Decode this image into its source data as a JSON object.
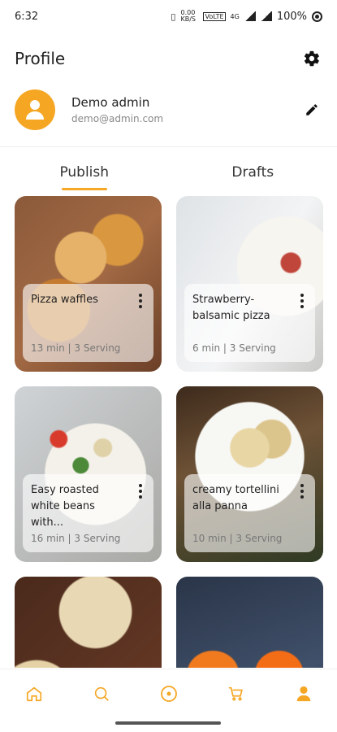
{
  "status_bar": {
    "time": "6:32",
    "net_speed": "0.00 KB/S",
    "network": "VoLTE",
    "signal_label": "4G",
    "battery": "100%"
  },
  "header": {
    "title": "Profile",
    "settings_icon": "gear-icon"
  },
  "profile": {
    "name": "Demo admin",
    "email": "demo@admin.com",
    "avatar_icon": "user-icon",
    "edit_icon": "pencil-icon"
  },
  "tabs": [
    {
      "label": "Publish",
      "active": true
    },
    {
      "label": "Drafts",
      "active": false
    }
  ],
  "recipes": [
    {
      "name": "Pizza waffles",
      "time": "13 min",
      "servings": "3 Serving",
      "meta": "13 min | 3 Serving"
    },
    {
      "name": "Strawberry-balsamic pizza",
      "time": "6 min",
      "servings": "3 Serving",
      "meta": "6 min | 3 Serving"
    },
    {
      "name": "Easy roasted white beans with...",
      "time": "16 min",
      "servings": "3 Serving",
      "meta": "16 min | 3 Serving"
    },
    {
      "name": "creamy tortellini alla panna",
      "time": "10 min",
      "servings": "3 Serving",
      "meta": "10 min | 3 Serving"
    },
    {
      "name": "",
      "meta": ""
    },
    {
      "name": "",
      "meta": ""
    }
  ],
  "bottom_nav": [
    {
      "icon": "home-icon",
      "active": false
    },
    {
      "icon": "search-icon",
      "active": false
    },
    {
      "icon": "add-circle-icon",
      "active": false
    },
    {
      "icon": "cart-icon",
      "active": false
    },
    {
      "icon": "profile-icon",
      "active": true
    }
  ],
  "colors": {
    "accent": "#f5a623",
    "text": "#222222",
    "muted": "#888888"
  }
}
